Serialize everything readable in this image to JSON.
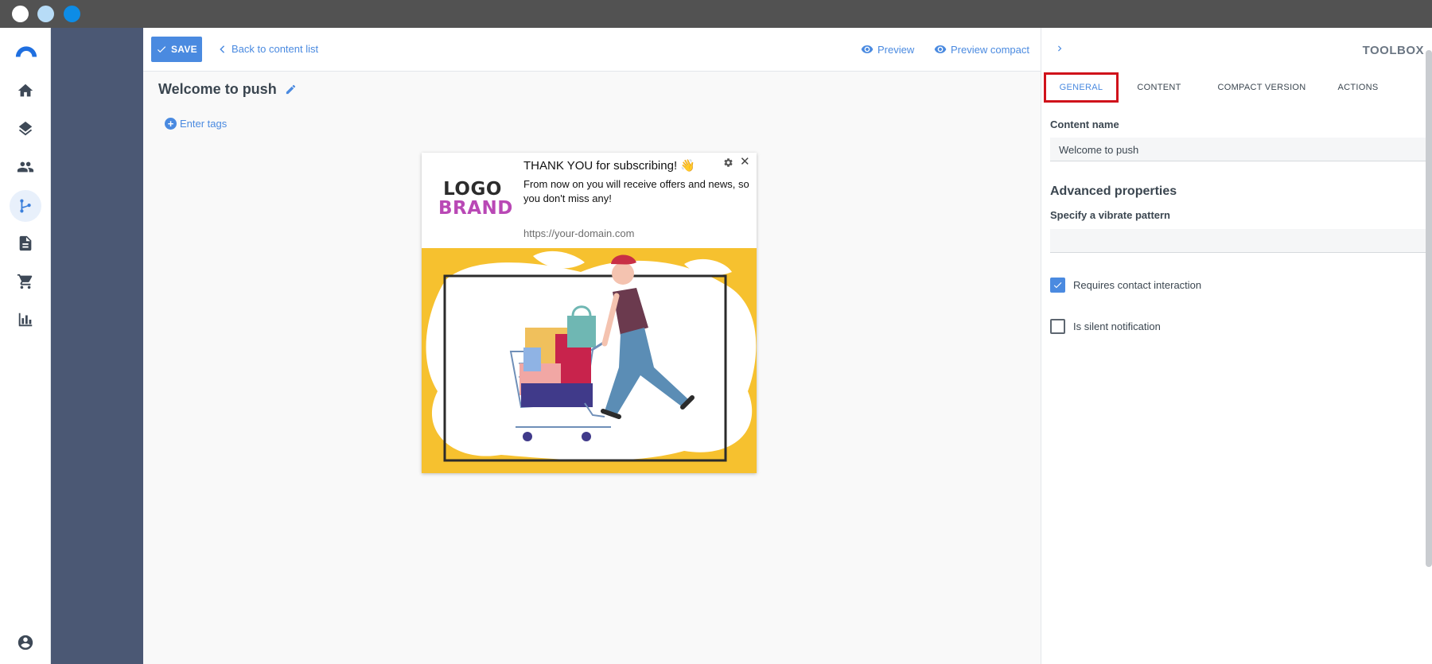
{
  "window": {
    "controls": [
      "close",
      "minimize",
      "maximize"
    ]
  },
  "nav": {
    "items": [
      {
        "icon": "home-icon"
      },
      {
        "icon": "layers-icon"
      },
      {
        "icon": "people-icon"
      },
      {
        "icon": "flow-icon",
        "active": true
      },
      {
        "icon": "document-icon"
      },
      {
        "icon": "cart-icon"
      },
      {
        "icon": "bar-chart-icon"
      }
    ],
    "bottom_icon": "account-icon",
    "accent": "#3c80dc"
  },
  "toolbar": {
    "save_label": "SAVE",
    "back_label": "Back to content list",
    "preview_label": "Preview",
    "preview_compact_label": "Preview compact"
  },
  "editor": {
    "title": "Welcome to push",
    "tags_label": "Enter tags"
  },
  "push_preview": {
    "logo_top": "LOGO",
    "logo_bottom": "BRAND",
    "title": "THANK YOU for subscribing! 👋",
    "body": "From now on you will receive offers and news, so you don't miss any!",
    "url": "https://your-domain.com",
    "close_symbol": "✕",
    "image": "shopping-illustration"
  },
  "toolbox": {
    "title": "TOOLBOX",
    "tabs": [
      {
        "label": "GENERAL",
        "active": true
      },
      {
        "label": "CONTENT"
      },
      {
        "label": "COMPACT VERSION"
      },
      {
        "label": "ACTIONS"
      }
    ],
    "content_name_label": "Content name",
    "content_name_value": "Welcome to push",
    "advanced_title": "Advanced properties",
    "vibrate_label": "Specify a vibrate pattern",
    "vibrate_value": "",
    "requires_interaction": {
      "label": "Requires contact interaction",
      "checked": true
    },
    "silent_notification": {
      "label": "Is silent notification",
      "checked": false
    }
  },
  "colors": {
    "accent": "#4a8ae0",
    "sidebar_dark": "#4b5874",
    "highlight": "#d0121b"
  }
}
